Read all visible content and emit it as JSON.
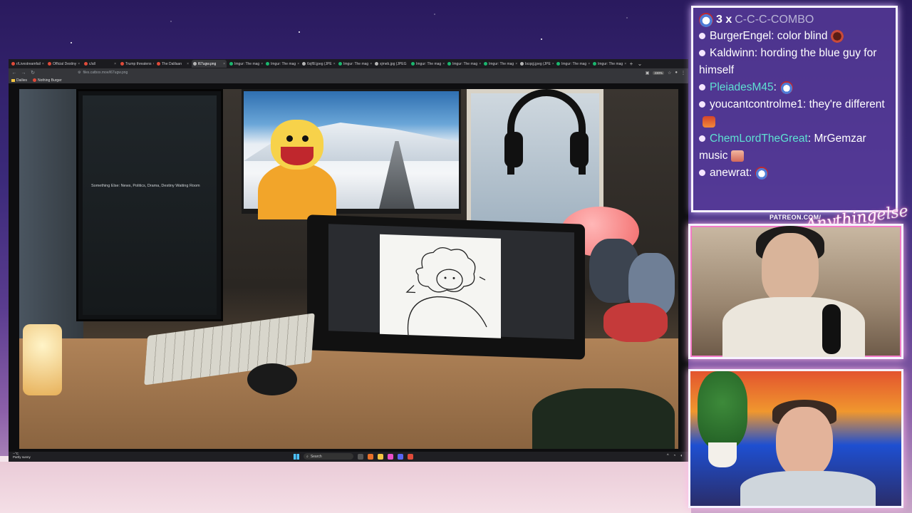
{
  "browser": {
    "tabs": [
      {
        "label": "r/Livestreamfail",
        "fav": "red"
      },
      {
        "label": "Official Destiny",
        "fav": "red"
      },
      {
        "label": "c/all",
        "fav": "red"
      },
      {
        "label": "Trump threatens",
        "fav": "red"
      },
      {
        "label": "The Dalilaan",
        "fav": "red"
      },
      {
        "label": "l67ugw.png",
        "fav": "white",
        "active": true
      },
      {
        "label": "Imgur: The mag",
        "fav": "green"
      },
      {
        "label": "Imgur: The mag",
        "fav": "green"
      },
      {
        "label": "6xjf6l.jpeg (JPE",
        "fav": "white"
      },
      {
        "label": "Imgur: The mag",
        "fav": "green"
      },
      {
        "label": "xjmeb.jpg (JPEG",
        "fav": "white"
      },
      {
        "label": "Imgur: The mag",
        "fav": "green"
      },
      {
        "label": "Imgur: The mag",
        "fav": "green"
      },
      {
        "label": "Imgur: The mag",
        "fav": "green"
      },
      {
        "label": "bcqsjj.jpeg (JPE",
        "fav": "white"
      },
      {
        "label": "Imgur: The mag",
        "fav": "green"
      },
      {
        "label": "Imgur: The mag",
        "fav": "green"
      }
    ],
    "url": "files.catbox.moe/l67ugw.png",
    "zoom": "230%",
    "bookmarks": [
      {
        "label": "Dailies",
        "icon": "folder-icon"
      },
      {
        "label": "Nothing Burger",
        "icon": "red-dot-icon"
      }
    ],
    "screen_text": "Something Else: News, Politics, Drama, Destiny Waiting Room"
  },
  "taskbar": {
    "weather_temp": "--°C",
    "weather_text": "Partly sunny",
    "search_placeholder": "Search"
  },
  "chat": {
    "combo_count": "3 x",
    "combo_label": "C-C-C-COMBO",
    "messages": [
      {
        "user": "BurgerEngel",
        "text": ": color blind",
        "emote": "brown"
      },
      {
        "user": "Kaldwinn",
        "text": ": hording the blue guy for himself",
        "emote": ""
      },
      {
        "user": "PleiadesM45",
        "text": ":",
        "emote": "blue",
        "color": "teal"
      },
      {
        "user": "youcantcontrolme1",
        "text": ": they're different",
        "emote": "food"
      },
      {
        "user": "ChemLordTheGreat",
        "text": ": MrGemzar music",
        "emote": "hand",
        "color": "teal"
      },
      {
        "user": "anewrat",
        "text": ":",
        "emote": "blue"
      }
    ]
  },
  "overlay": {
    "patreon": "PATREON.COM/",
    "signature": "Anythingelse"
  },
  "colors": {
    "accent_pink": "#f37ac6",
    "chat_bg": "#5c3ea0",
    "teal_user": "#5ee0d2"
  }
}
